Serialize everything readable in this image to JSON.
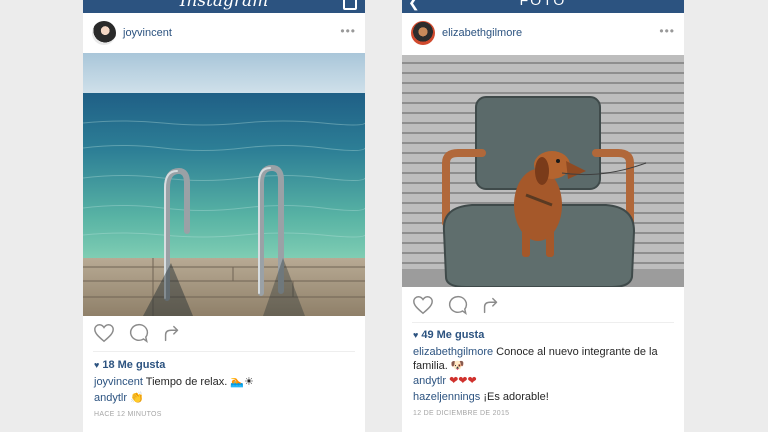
{
  "left_post": {
    "app_title": "Instagram",
    "username": "joyvincent",
    "more": "•••",
    "likes": "18 Me gusta",
    "heart_glyph": "♥",
    "caption_user": "joyvincent",
    "caption_text": "Tiempo de relax. 🏊☀",
    "comments": [
      {
        "user": "andytlr",
        "text": "👏"
      }
    ],
    "time": "HACE 12 MINUTOS"
  },
  "right_post": {
    "app_title": "FOTO",
    "username": "elizabethgilmore",
    "more": "•••",
    "likes": "49 Me gusta",
    "heart_glyph": "♥",
    "caption_user": "elizabethgilmore",
    "caption_text": "Conoce al nuevo integrante de la familia. 🐶",
    "comments": [
      {
        "user": "andytlr",
        "text": "❤❤❤"
      },
      {
        "user": "hazeljennings",
        "text": "¡Es adorable!"
      }
    ],
    "time": "12 DE DICIEMBRE DE 2015"
  },
  "colors": {
    "brand_blue": "#2c5380",
    "text": "#262626",
    "muted": "#a6a6a6",
    "background": "#ececec"
  },
  "icons": [
    "camera-inbox-icon",
    "back-arrow-icon",
    "more-icon",
    "heart-icon",
    "comment-icon",
    "share-icon"
  ]
}
